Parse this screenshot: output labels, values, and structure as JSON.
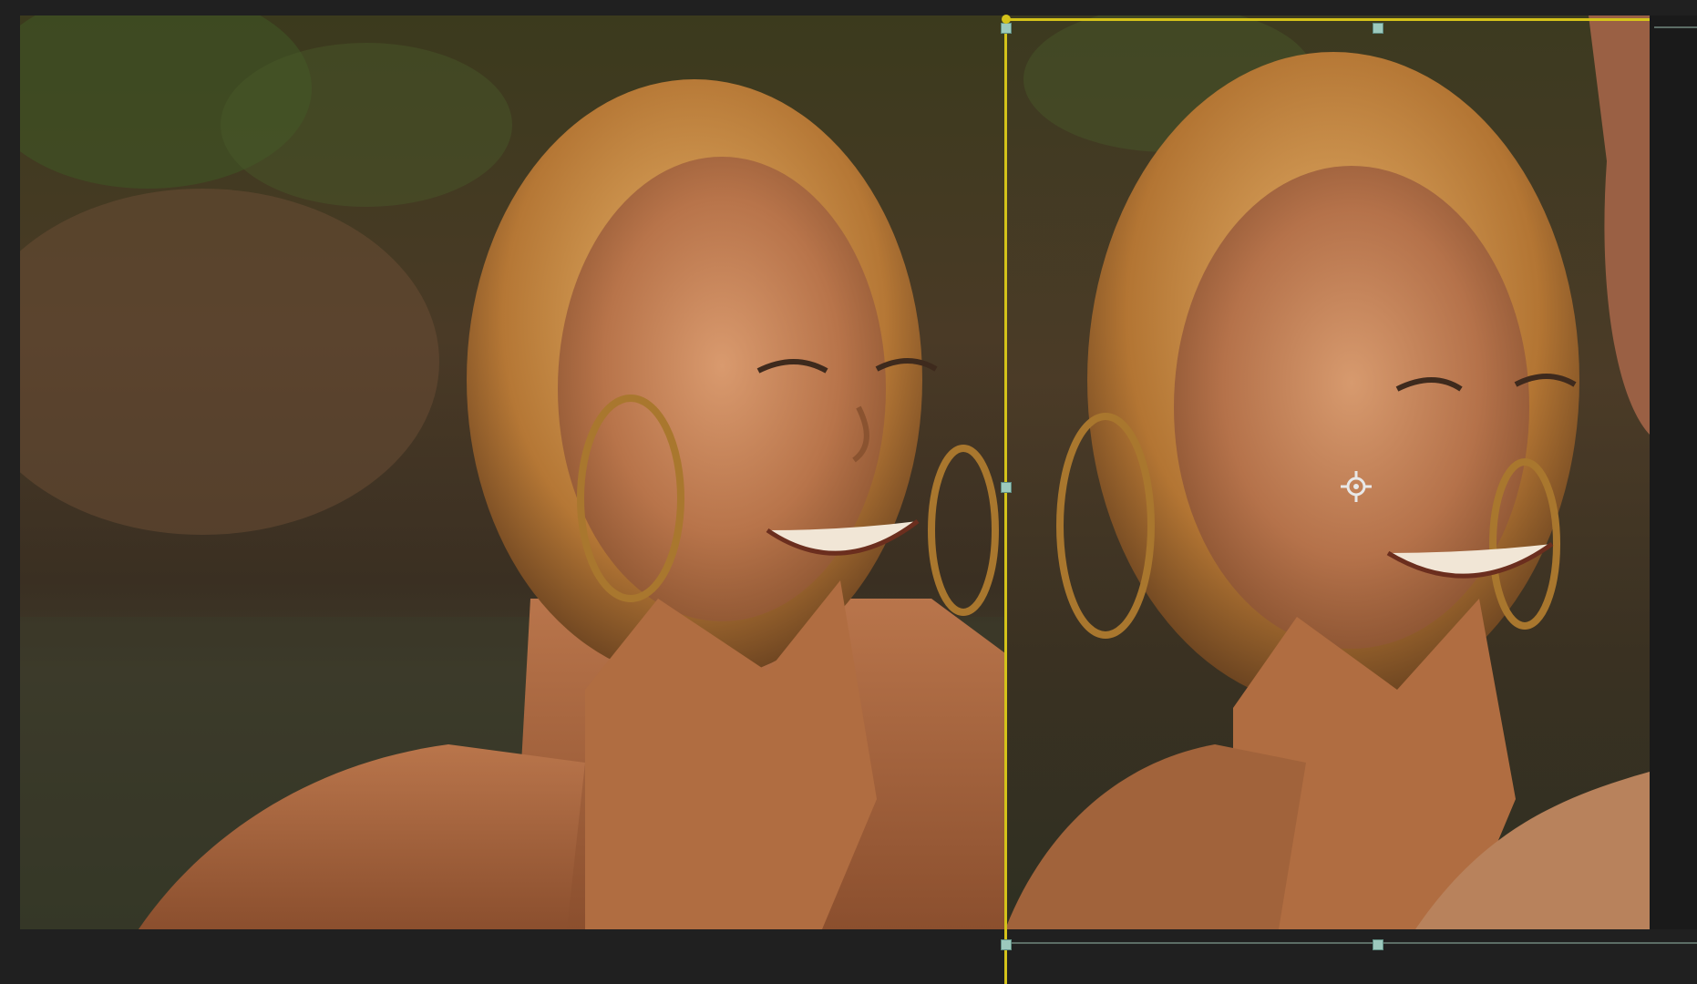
{
  "app": {
    "window_title": "",
    "panel": "program-monitor"
  },
  "viewer": {
    "background_color": "#202020",
    "mask_color": "#d4c21a",
    "handle_color": "#9cc9bd"
  },
  "clip": {
    "left_clip": "original-frame",
    "right_clip": "zoomed-frame",
    "mask": "rectangle-mask",
    "anchor": "position-crosshair"
  },
  "icons": {
    "pin": "crosshair-target-icon",
    "handle": "square-handle-icon"
  }
}
